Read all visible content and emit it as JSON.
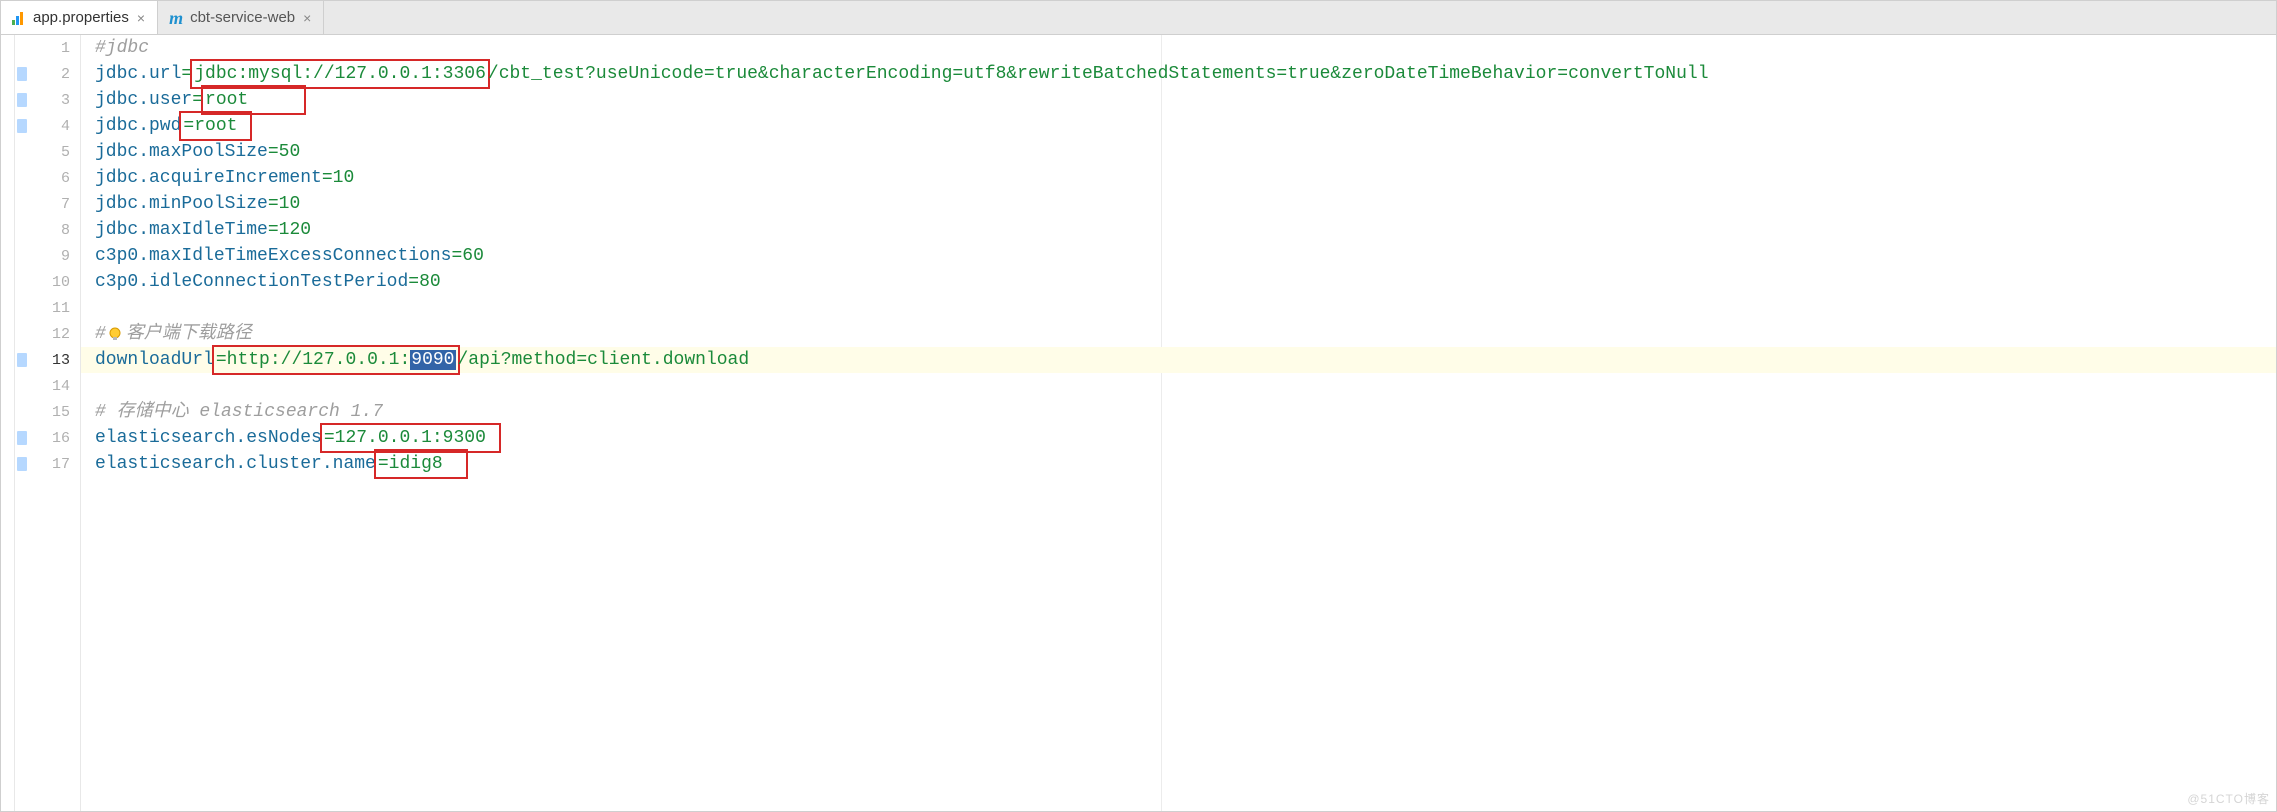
{
  "tabs": [
    {
      "label": "app.properties",
      "icon": "properties-file-icon",
      "active": true
    },
    {
      "label": "cbt-service-web",
      "icon": "maven-module-icon",
      "active": false
    }
  ],
  "current_line": 13,
  "gutter": {
    "lines": [
      "1",
      "2",
      "3",
      "4",
      "5",
      "6",
      "7",
      "8",
      "9",
      "10",
      "11",
      "12",
      "13",
      "14",
      "15",
      "16",
      "17"
    ],
    "change_markers_on": [
      2,
      3,
      4,
      13,
      16,
      17
    ]
  },
  "code": {
    "l1": {
      "comment": "#jdbc"
    },
    "l2": {
      "key": "jdbc.url",
      "box": "jdbc:mysql://127.0.0.1:3306",
      "rest": "/cbt_test?useUnicode=true&characterEncoding=utf8&rewriteBatchedStatements=true&zeroDateTimeBehavior=convertToNull"
    },
    "l3": {
      "key": "jdbc.user",
      "box": "root"
    },
    "l4": {
      "key": "jdbc.pwd",
      "box": "root"
    },
    "l5": {
      "key": "jdbc.maxPoolSize",
      "val": "50"
    },
    "l6": {
      "key": "jdbc.acquireIncrement",
      "val": "10"
    },
    "l7": {
      "key": "jdbc.minPoolSize",
      "val": "10"
    },
    "l8": {
      "key": "jdbc.maxIdleTime",
      "val": "120"
    },
    "l9": {
      "key": "c3p0.maxIdleTimeExcessConnections",
      "val": "60"
    },
    "l10": {
      "key": "c3p0.idleConnectionTestPeriod",
      "val": "80"
    },
    "l12": {
      "comment_prefix": "#",
      "comment_text": "客户端下载路径",
      "has_bulb": true
    },
    "l13": {
      "key": "downloadUrl",
      "box_pre": "http://127.0.0.1:",
      "box_sel": "9090",
      "rest": "/api?method=client.download"
    },
    "l15": {
      "comment": "# 存储中心 elasticsearch 1.7"
    },
    "l16": {
      "key": "elasticsearch.esNodes",
      "box": "127.0.0.1:9300"
    },
    "l17": {
      "key": "elasticsearch.cluster.name",
      "box": "idig8"
    }
  },
  "watermark": "@51CTO博客"
}
